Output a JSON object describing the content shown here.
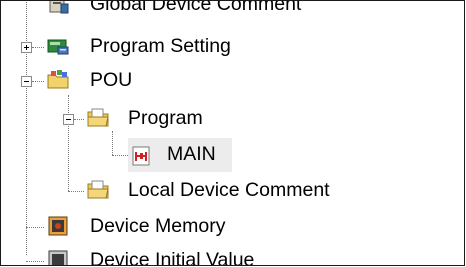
{
  "tree": {
    "items": [
      {
        "label": "Global Device Comment",
        "icon": "comment-book-icon"
      },
      {
        "label": "Program Setting",
        "icon": "program-setting-icon",
        "expander": "+"
      },
      {
        "label": "POU",
        "icon": "pou-folder-icon",
        "expander": "-"
      },
      {
        "label": "Program",
        "icon": "program-folder-icon",
        "expander": "-"
      },
      {
        "label": "MAIN",
        "icon": "ladder-program-icon",
        "selected": true
      },
      {
        "label": "Local Device Comment",
        "icon": "comment-folder-icon"
      },
      {
        "label": "Device Memory",
        "icon": "device-memory-icon"
      },
      {
        "label": "Device Initial Value",
        "icon": "device-initial-value-icon"
      }
    ]
  },
  "colors": {
    "selection_bg": "#ececec",
    "tree_line": "#7a7a7a",
    "frame_border": "#1a1a1a"
  }
}
